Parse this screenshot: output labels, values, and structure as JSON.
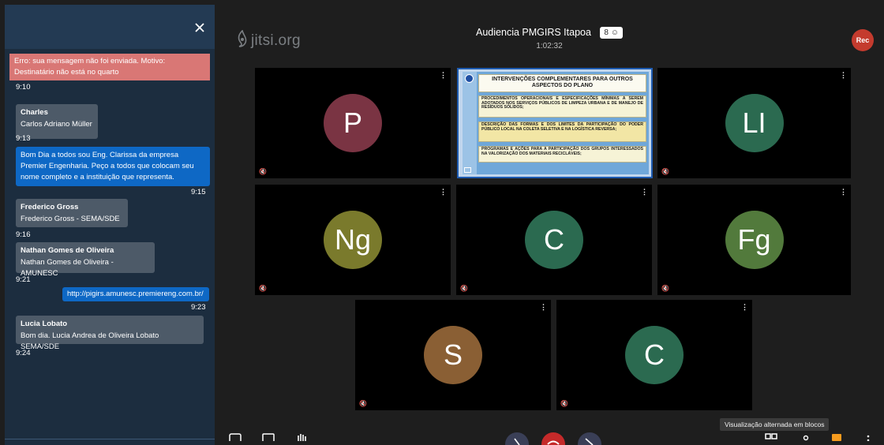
{
  "chat": {
    "close_icon": "close-icon",
    "messages": [
      {
        "type": "error",
        "text": "Erro: sua mensagem não foi enviada. Motivo: Destinatário não está no quarto",
        "time": "9:10"
      },
      {
        "type": "incoming",
        "sender": "Charles",
        "text": "Carlos Adriano Müller",
        "time": "9:13"
      },
      {
        "type": "own",
        "text": "Bom Dia a todos sou Eng. Clarissa da empresa Premier Engenharia. Peço a todos que colocam seu nome completo e a instituição que representa.",
        "time": "9:15"
      },
      {
        "type": "incoming",
        "sender": "Frederico Gross",
        "text": "Frederico Gross - SEMA/SDE",
        "time": "9:16"
      },
      {
        "type": "incoming",
        "sender": "Nathan Gomes de Oliveira",
        "text": "Nathan Gomes de Oliveira - AMUNESC",
        "time": "9:21"
      },
      {
        "type": "own",
        "text": "http://pigirs.amunesc.premiereng.com.br/",
        "time": "9:23"
      },
      {
        "type": "incoming",
        "sender": "Lucia Lobato",
        "text": "Bom dia. Lucia Andrea de Oliveira Lobato SEMA/SDE",
        "time": "9:24"
      }
    ]
  },
  "header": {
    "logo": "jitsi.org",
    "meeting_title": "Audiencia PMGIRS Itapoa",
    "participant_count": "8",
    "duration": "1:02:32",
    "rec_label": "Rec"
  },
  "tiles": [
    {
      "initials": "P",
      "color": "#7a3443"
    },
    {
      "initials": "LI",
      "color": "#2b6a50"
    },
    {
      "initials": "Ng",
      "color": "#7a7a2c"
    },
    {
      "initials": "C",
      "color": "#2b6a50"
    },
    {
      "initials": "Fg",
      "color": "#527a3c"
    },
    {
      "initials": "S",
      "color": "#8a5f34"
    },
    {
      "initials": "C",
      "color": "#2b6a50"
    }
  ],
  "slide": {
    "title": "INTERVENÇÕES COMPLEMENTARES PARA OUTROS ASPECTOS DO PLANO",
    "item1": "PROCEDIMENTOS OPERACIONAIS E ESPECIFICAÇÕES MÍNIMAS A SEREM ADOTADOS NOS SERVIÇOS PÚBLICOS DE LIMPEZA URBANA E DE MANEJO DE RESÍDUOS SÓLIDOS;",
    "item2": "DESCRIÇÃO DAS FORMAS E DOS LIMITES DA PARTICIPAÇÃO DO PODER PÚBLICO LOCAL NA COLETA SELETIVA E NA LOGÍSTICA REVERSA;",
    "item3": "PROGRAMAS E AÇÕES PARA A PARTICIPAÇÃO DOS GRUPOS INTERESSADOS NA VALORIZAÇÃO DOS MATERIAIS RECICLÁVEIS;"
  },
  "tile_menu_glyph": "⋮",
  "tooltip": "Visualização alternada em blocos"
}
